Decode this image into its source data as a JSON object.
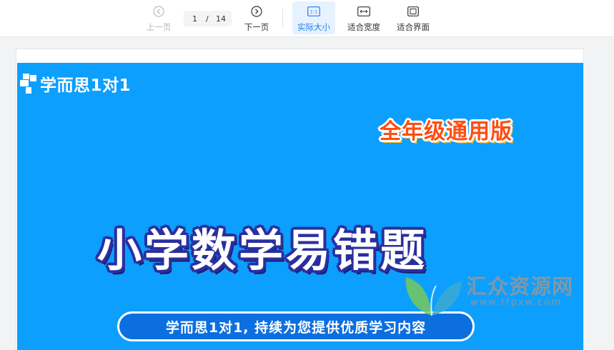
{
  "toolbar": {
    "prev_label": "上一页",
    "next_label": "下一页",
    "page_current": "1",
    "page_separator": "/",
    "page_total": "14",
    "actual_size_label": "实际大小",
    "fit_width_label": "适合宽度",
    "fit_page_label": "适合界面",
    "actual_size_icon_text": "1:1",
    "icons": [
      "chevron-left-circle-icon",
      "chevron-right-circle-icon",
      "actual-size-icon",
      "fit-width-icon",
      "fit-page-icon"
    ]
  },
  "slide": {
    "brand": "学而思1对1",
    "badge": "全年级通用版",
    "title": "小学数学易错题",
    "subtitle": "学而思1对1, 持续为您提供优质学习内容"
  },
  "watermark": {
    "name": "汇众资源网",
    "url": "www.tfpxw.com"
  },
  "colors": {
    "slide_blue": "#0d9ffd",
    "accent_active": "#1a7cf0",
    "badge_orange": "#ff4d12",
    "title_outline": "#2a2f9e"
  }
}
